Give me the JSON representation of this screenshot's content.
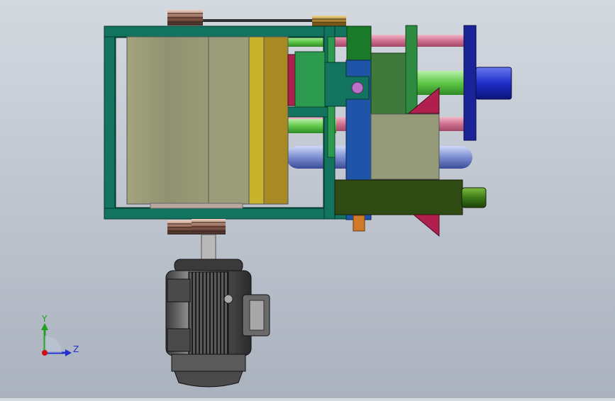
{
  "viewport": {
    "background_top": "#d4d9e0",
    "background_bottom": "#aab2be"
  },
  "triad": {
    "axis_y_label": "Y",
    "axis_z_label": "Z",
    "colors": {
      "y": "#1fa01f",
      "z": "#2030d0",
      "x": "#d01010"
    }
  },
  "model_colors": {
    "frame": "#12745f",
    "drum": "#9a9a74",
    "drum_band_yellow": "#c9b22c",
    "drum_band_gold": "#a88a24",
    "block_green": "#2d9b4f",
    "column_blue": "#1f55a8",
    "crimson": "#b0204e",
    "rod_pink": "#d8809c",
    "rod_green": "#6ad04a",
    "rod_blue": "#8898d8",
    "flange_navy": "#1a2398",
    "shaft_blue": "#2030c8",
    "olive_block": "#2f4a12",
    "tan_box": "#959a78",
    "motor_dark": "#4a4a4a"
  }
}
